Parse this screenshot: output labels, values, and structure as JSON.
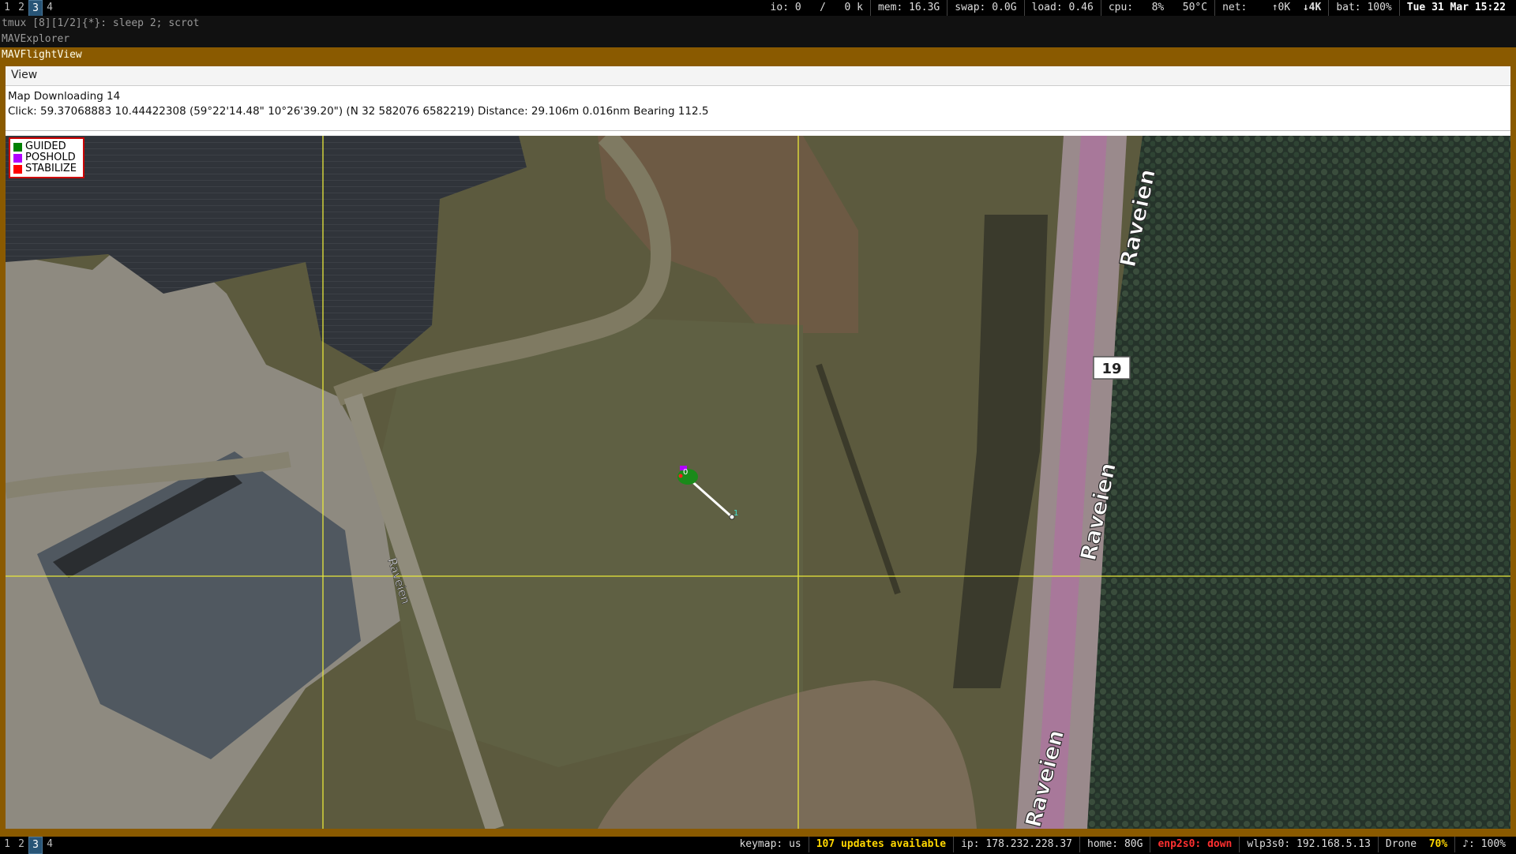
{
  "topbar": {
    "workspaces": [
      "1",
      "2",
      "3",
      "4"
    ],
    "active_workspace": "3",
    "io": "io: 0",
    "io_sep": "/",
    "io_k": "0 k",
    "mem": "mem: 16.3G",
    "swap": "swap: 0.0G",
    "load": "load: 0.46",
    "cpu": "cpu:",
    "cpu_pct": "8%",
    "temp": "50°C",
    "net": "net:",
    "net_up": "↑0K",
    "net_down": "↓4K",
    "bat": "bat: 100%",
    "datetime": "Tue 31 Mar 15:22"
  },
  "tmux_line": "tmux [8][1/2]{*}:  sleep 2; scrot",
  "explorer_title": "MAVExplorer",
  "flightview_title": "MAVFlightView",
  "menu": {
    "view": "View"
  },
  "info": {
    "line1": "Map Downloading 14",
    "line2": "Click: 59.37068883 10.44422308 (59°22'14.48\" 10°26'39.20\") (N 32 582076 6582219)  Distance: 29.106m 0.016nm Bearing 112.5"
  },
  "legend": [
    {
      "label": "GUIDED",
      "color": "#008000"
    },
    {
      "label": "POSHOLD",
      "color": "#b000ff"
    },
    {
      "label": "STABILIZE",
      "color": "#ff0000"
    }
  ],
  "map": {
    "road_labels": [
      "Raveien",
      "Raveien",
      "Raveien",
      "Raveien"
    ],
    "route_shield": "19",
    "waypoints": [
      "0",
      "1"
    ]
  },
  "bottombar": {
    "workspaces": [
      "1",
      "2",
      "3",
      "4"
    ],
    "active_workspace": "3",
    "keymap": "keymap: us",
    "updates": "107 updates available",
    "ip": "ip: 178.232.228.37",
    "home": "home: 80G",
    "enp": "enp2s0: down",
    "wlp": "wlp3s0: 192.168.5.13",
    "drone": "Drone",
    "drone_pct": "70%",
    "volume": "♪: 100%"
  }
}
